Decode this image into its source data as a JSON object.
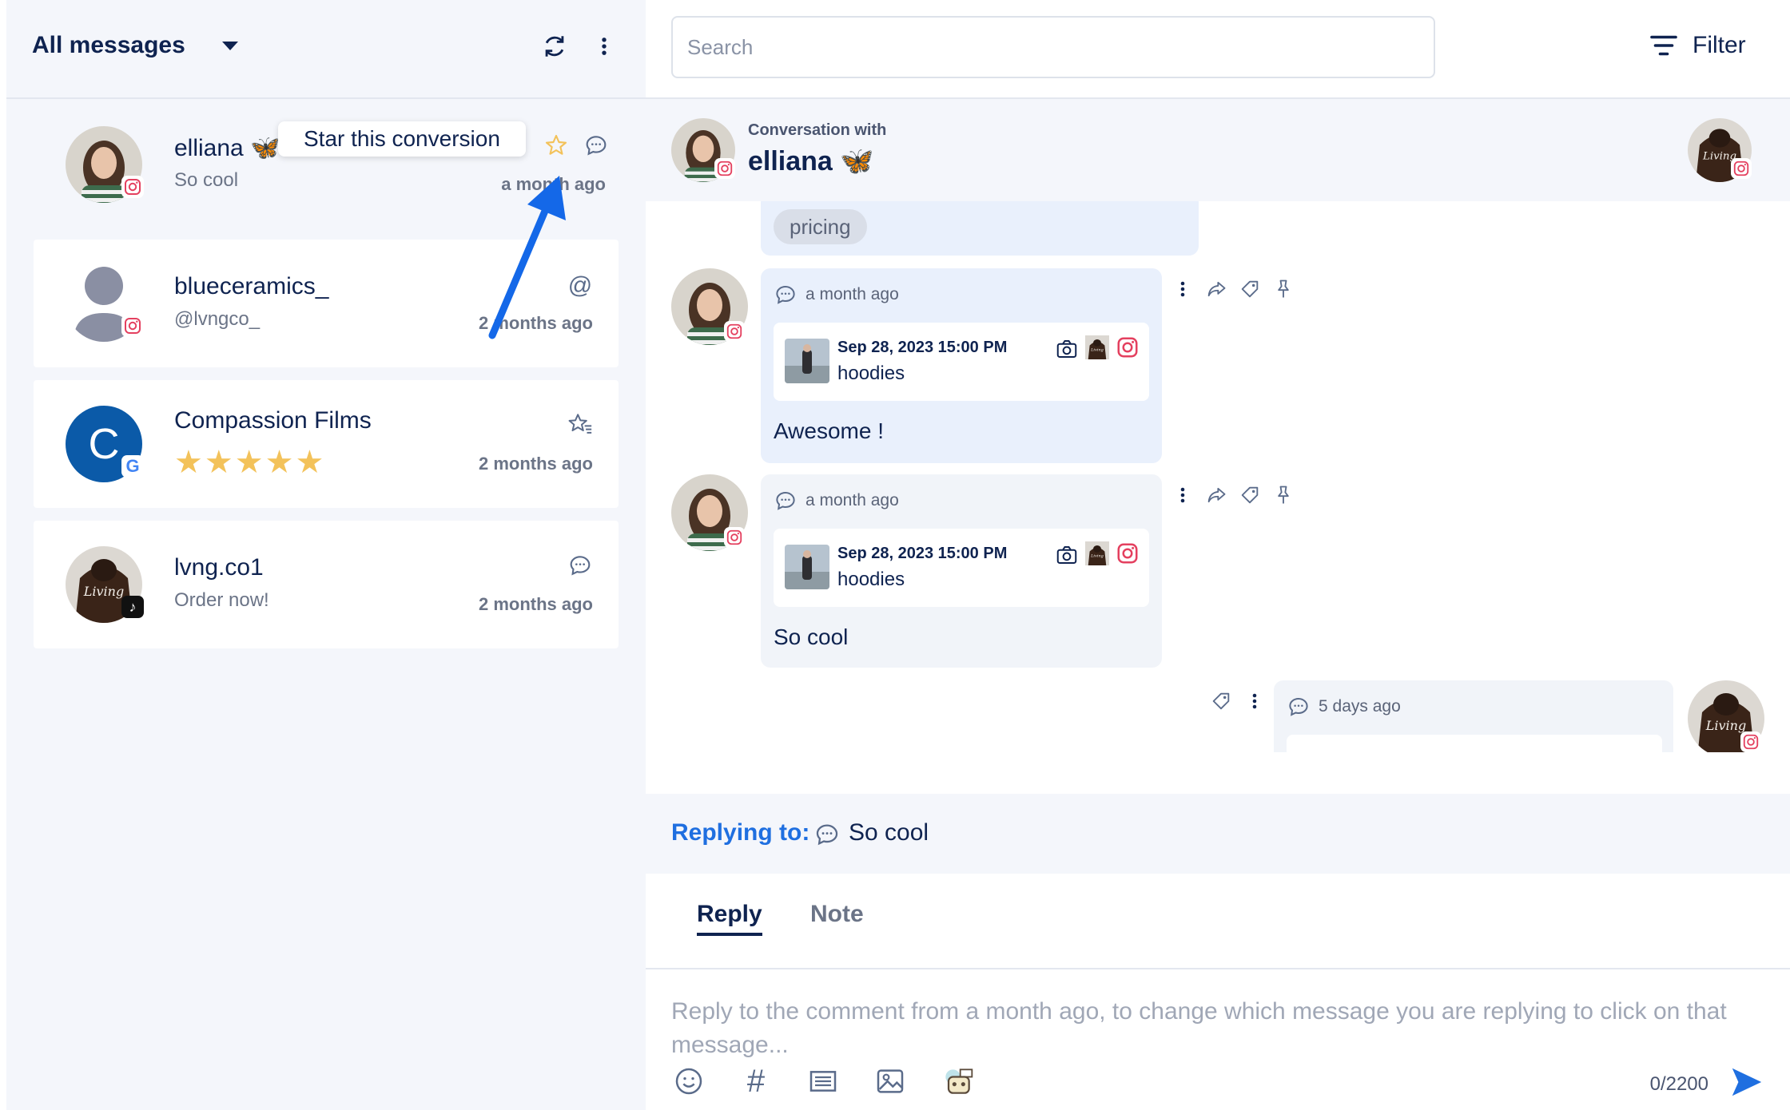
{
  "left": {
    "folder_title": "All messages",
    "conversations": [
      {
        "name": "elliana 🦋",
        "preview": "So cool",
        "time": "a month ago",
        "platform": "instagram"
      },
      {
        "name": "blueceramics_",
        "preview": "@lvngco_",
        "time": "2 months ago",
        "platform": "instagram"
      },
      {
        "name": "Compassion Films",
        "preview": "★★★★★",
        "time": "2 months ago",
        "platform": "google",
        "avatar_letter": "C"
      },
      {
        "name": "lvng.co1",
        "preview": "Order now!",
        "time": "2 months ago",
        "platform": "tiktok"
      }
    ],
    "tooltip": "Star this conversion"
  },
  "right": {
    "search_placeholder": "Search",
    "filter_label": "Filter",
    "conv_label": "Conversation with",
    "conv_name": "elliana 🦋",
    "messages": [
      {
        "tag": "pricing"
      },
      {
        "time": "a month ago",
        "post_date": "Sep 28, 2023 15:00 PM",
        "post_title": "hoodies",
        "text": "Awesome !"
      },
      {
        "time": "a month ago",
        "post_date": "Sep 28, 2023 15:00 PM",
        "post_title": "hoodies",
        "text": "So cool"
      },
      {
        "time": "5 days ago"
      }
    ],
    "replying_label": "Replying to:",
    "replying_text": "So cool",
    "tabs": [
      "Reply",
      "Note"
    ],
    "composer_placeholder": "Reply to the comment from a month ago, to change which message you are replying to click on that message...",
    "counter": "0/2200"
  },
  "colors": {
    "accent": "#1f6fe0",
    "navy": "#0f2350",
    "star": "#f3c25a",
    "instagram": "#e4405f"
  }
}
